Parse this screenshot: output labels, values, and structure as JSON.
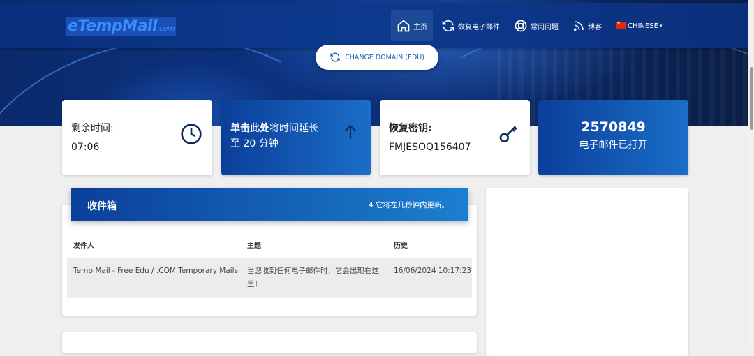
{
  "header": {
    "logo_main": "eTempMail",
    "logo_suffix": ".com",
    "nav": [
      {
        "label": "主页",
        "icon": "home-icon"
      },
      {
        "label": "恢复电子邮件",
        "icon": "refresh-icon"
      },
      {
        "label": "常问问题",
        "icon": "lifebuoy-icon"
      },
      {
        "label": "博客",
        "icon": "rss-icon"
      },
      {
        "label": "CHINESE",
        "icon": "china-flag-icon"
      }
    ]
  },
  "change_domain": {
    "label": "CHANGE DOMAIN (EDU)",
    "icon": "refresh-icon"
  },
  "cards": {
    "time": {
      "label": "剩余时间:",
      "value": "07:06",
      "icon": "clock-icon"
    },
    "extend": {
      "label_bold": "单击此处",
      "label_rest": "将时间延长",
      "label_line2": "至 20 分钟",
      "icon": "arrow-up-icon"
    },
    "recovery": {
      "label": "恢复密钥:",
      "value": "FMJESOQ156407",
      "icon": "key-icon"
    },
    "stats": {
      "number": "2570849",
      "label": "电子邮件已打开"
    }
  },
  "inbox": {
    "title": "收件箱",
    "status": "4 它将在几秒钟内更新。",
    "columns": [
      "发件人",
      "主题",
      "历史"
    ],
    "rows": [
      {
        "sender": "Temp Mail - Free Edu / .COM Temporary Mails",
        "subject": "当您收到任何电子邮件时，它会出现在这里！",
        "date": "16/06/2024 10:17:23"
      }
    ]
  },
  "colors": {
    "brand_blue": "#0b3f9a",
    "accent_blue": "#1b7fcf",
    "background": "#efefef"
  }
}
